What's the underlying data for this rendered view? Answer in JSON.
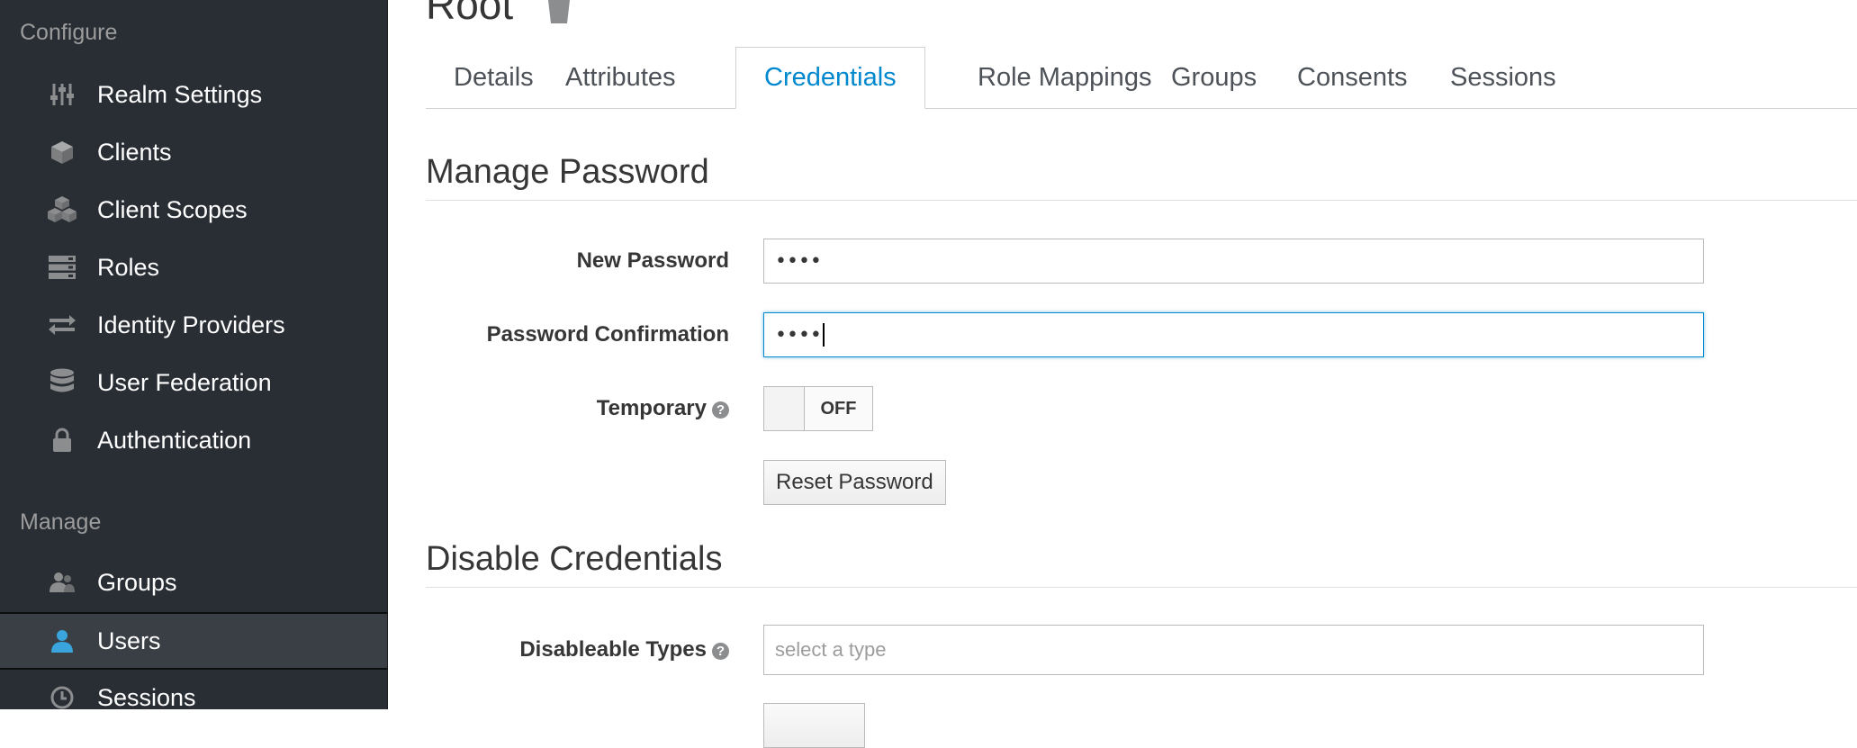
{
  "sidebar": {
    "configure_label": "Configure",
    "manage_label": "Manage",
    "configure_items": [
      {
        "label": "Realm Settings",
        "icon": "sliders-icon"
      },
      {
        "label": "Clients",
        "icon": "cube-icon"
      },
      {
        "label": "Client Scopes",
        "icon": "cubes-icon"
      },
      {
        "label": "Roles",
        "icon": "list-icon"
      },
      {
        "label": "Identity Providers",
        "icon": "exchange-icon"
      },
      {
        "label": "User Federation",
        "icon": "database-icon"
      },
      {
        "label": "Authentication",
        "icon": "lock-icon"
      }
    ],
    "manage_items": [
      {
        "label": "Groups",
        "icon": "users-icon"
      },
      {
        "label": "Users",
        "icon": "user-icon",
        "active": true
      },
      {
        "label": "Sessions",
        "icon": "clock-icon"
      }
    ]
  },
  "page": {
    "title": "Root"
  },
  "tabs": [
    {
      "label": "Details"
    },
    {
      "label": "Attributes"
    },
    {
      "label": "Credentials",
      "active": true
    },
    {
      "label": "Role Mappings"
    },
    {
      "label": "Groups"
    },
    {
      "label": "Consents"
    },
    {
      "label": "Sessions"
    }
  ],
  "manage_password": {
    "heading": "Manage Password",
    "new_password_label": "New Password",
    "new_password_value": "••••",
    "confirmation_label": "Password Confirmation",
    "confirmation_value": "••••",
    "temporary_label": "Temporary",
    "temporary_toggle": "OFF",
    "reset_button": "Reset Password"
  },
  "disable_credentials": {
    "heading": "Disable Credentials",
    "types_label": "Disableable Types",
    "types_placeholder": "select a type"
  },
  "colors": {
    "sidebar_bg": "#292e34",
    "active_item_bg": "#393f44",
    "accent": "#0088ce",
    "user_icon": "#39a5dc"
  }
}
